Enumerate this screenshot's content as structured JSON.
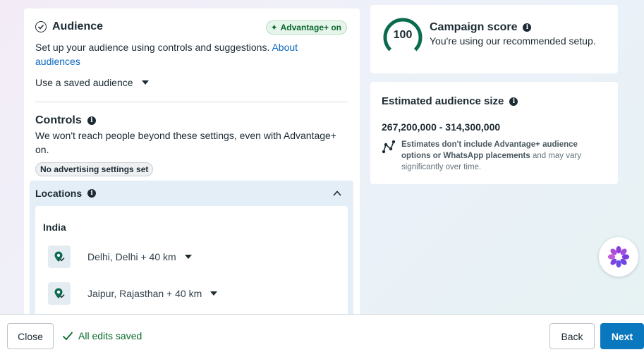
{
  "audience": {
    "title": "Audience",
    "badge": "Advantage+ on",
    "description": "Set up your audience using controls and suggestions.",
    "about_link": "About audiences",
    "saved_select": "Use a saved audience"
  },
  "controls": {
    "title": "Controls",
    "description": "We won't reach people beyond these settings, even with Advantage+ on.",
    "pill": "No advertising settings set"
  },
  "locations": {
    "title": "Locations",
    "country": "India",
    "items": [
      {
        "label": "Delhi, Delhi + 40 km"
      },
      {
        "label": "Jaipur, Rajasthan + 40 km"
      }
    ]
  },
  "score": {
    "value": "100",
    "title": "Campaign score",
    "subtitle": "You're using our recommended setup."
  },
  "audience_size": {
    "title": "Estimated audience size",
    "range": "267,200,000 - 314,300,000",
    "note_prefix": "Estimates don't include Advantage+ audience options or WhatsApp placements",
    "note_suffix": " and may vary significantly over time."
  },
  "footer": {
    "close_label": "Close",
    "saved_status": "All edits saved",
    "back_label": "Back",
    "next_label": "Next"
  },
  "colors": {
    "primary": "#0a78be",
    "success": "#0a6b2d",
    "gauge": "#0a6b4f",
    "link": "#0a66c2"
  }
}
